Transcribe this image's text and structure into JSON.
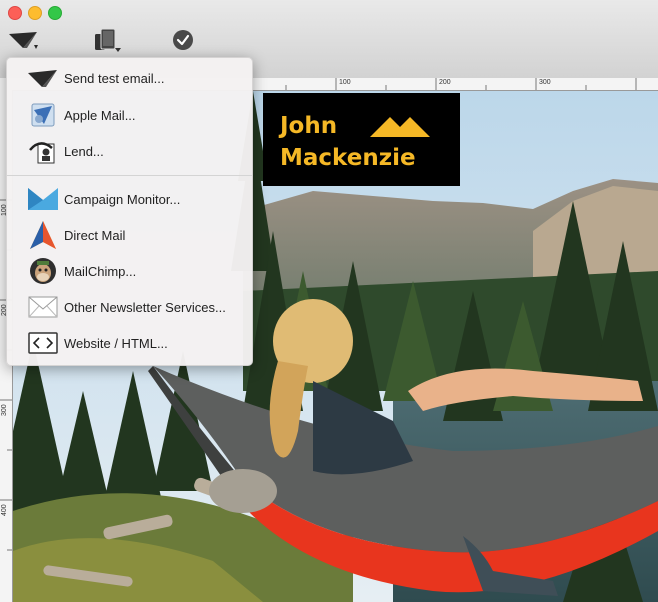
{
  "toolbar": {
    "share_icon": "paper-plane-icon",
    "devices_icon": "devices-icon",
    "check_icon": "checkmark-icon"
  },
  "ruler": {
    "top_ticks": [
      "100",
      "200",
      "300"
    ],
    "left_ticks": [
      "100",
      "200",
      "300",
      "400"
    ]
  },
  "canvas": {
    "logo_line1": "John",
    "logo_line2": "Mackenzie",
    "logo_color": "#f5b826"
  },
  "menu": {
    "items": [
      {
        "label": "Send test email...",
        "icon": "paper-plane-icon"
      },
      {
        "label": "Apple Mail...",
        "icon": "apple-mail-icon"
      },
      {
        "label": "Lend...",
        "icon": "lend-icon"
      },
      {
        "label": "Campaign Monitor...",
        "icon": "campaign-monitor-icon"
      },
      {
        "label": "Direct Mail",
        "icon": "direct-mail-icon"
      },
      {
        "label": "MailChimp...",
        "icon": "mailchimp-icon"
      },
      {
        "label": "Other Newsletter Services...",
        "icon": "envelope-icon"
      },
      {
        "label": "Website / HTML...",
        "icon": "html-code-icon"
      }
    ]
  }
}
